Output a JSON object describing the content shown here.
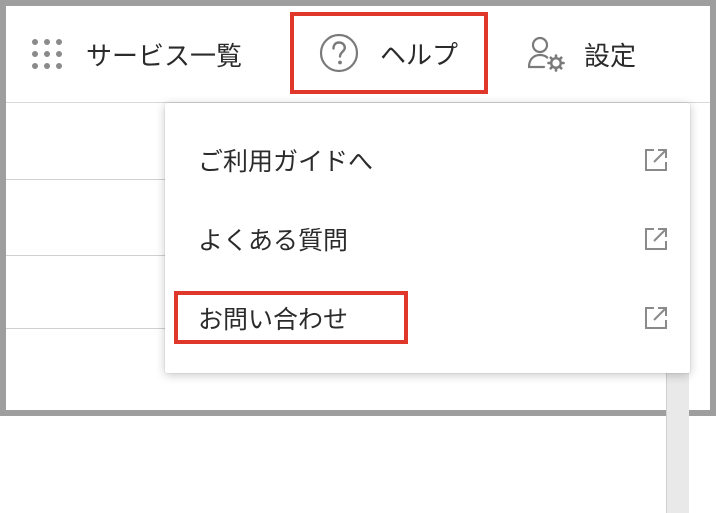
{
  "topbar": {
    "services": {
      "icon": "grid-icon",
      "label": "サービス一覧"
    },
    "help": {
      "icon": "help-circle-icon",
      "label": "ヘルプ"
    },
    "settings": {
      "icon": "user-settings-icon",
      "label": "設定"
    }
  },
  "help_menu": {
    "items": [
      {
        "label": "ご利用ガイドへ",
        "icon": "external-link-icon"
      },
      {
        "label": "よくある質問",
        "icon": "external-link-icon"
      },
      {
        "label": "お問い合わせ",
        "icon": "external-link-icon"
      }
    ]
  },
  "colors": {
    "highlight": "#e0372b",
    "icon_gray": "#7a7a7a",
    "text": "#2b2b2b"
  }
}
